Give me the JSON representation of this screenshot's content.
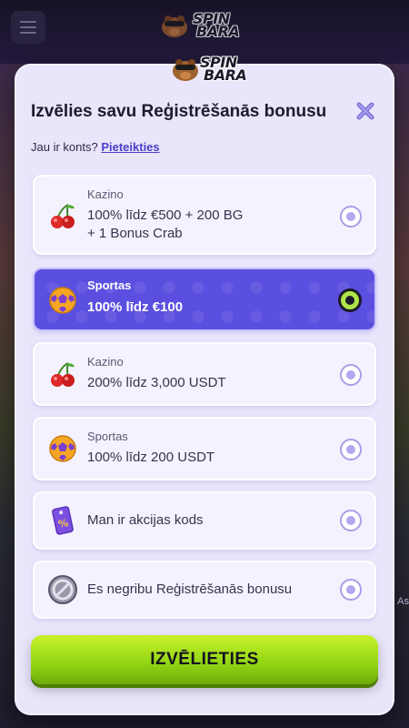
{
  "brand": {
    "line1": "SPIN",
    "line2": "BARA"
  },
  "background": {
    "side_text": "As"
  },
  "modal": {
    "title": "Izvēlies savu Reģistrēšanās bonusu",
    "login_prompt": "Jau ir konts?",
    "login_link": "Pieteikties",
    "options": [
      {
        "category": "Kazino",
        "text_line1": "100% līdz €500 + 200 BG",
        "text_line2": "+ 1 Bonus Crab",
        "icon": "cherries-icon",
        "selected": false
      },
      {
        "category": "Sportas",
        "text_line1": "100% līdz €100",
        "icon": "football-icon",
        "selected": true
      },
      {
        "category": "Kazino",
        "text_line1": "200% līdz 3,000 USDT",
        "icon": "cherries-icon",
        "selected": false
      },
      {
        "category": "Sportas",
        "text_line1": "100% līdz 200 USDT",
        "icon": "football-icon",
        "selected": false
      },
      {
        "category": "",
        "text_line1": "Man ir akcijas kods",
        "icon": "promo-ticket-icon",
        "selected": false
      },
      {
        "category": "",
        "text_line1": "Es negribu Reģistrēšanās bonusu",
        "icon": "no-bonus-icon",
        "selected": false
      }
    ],
    "cta_label": "IZVĒLIETIES"
  },
  "colors": {
    "accent": "#5b4fe0",
    "cta": "#9bdb14",
    "modal_bg": "#e9e5fb"
  }
}
